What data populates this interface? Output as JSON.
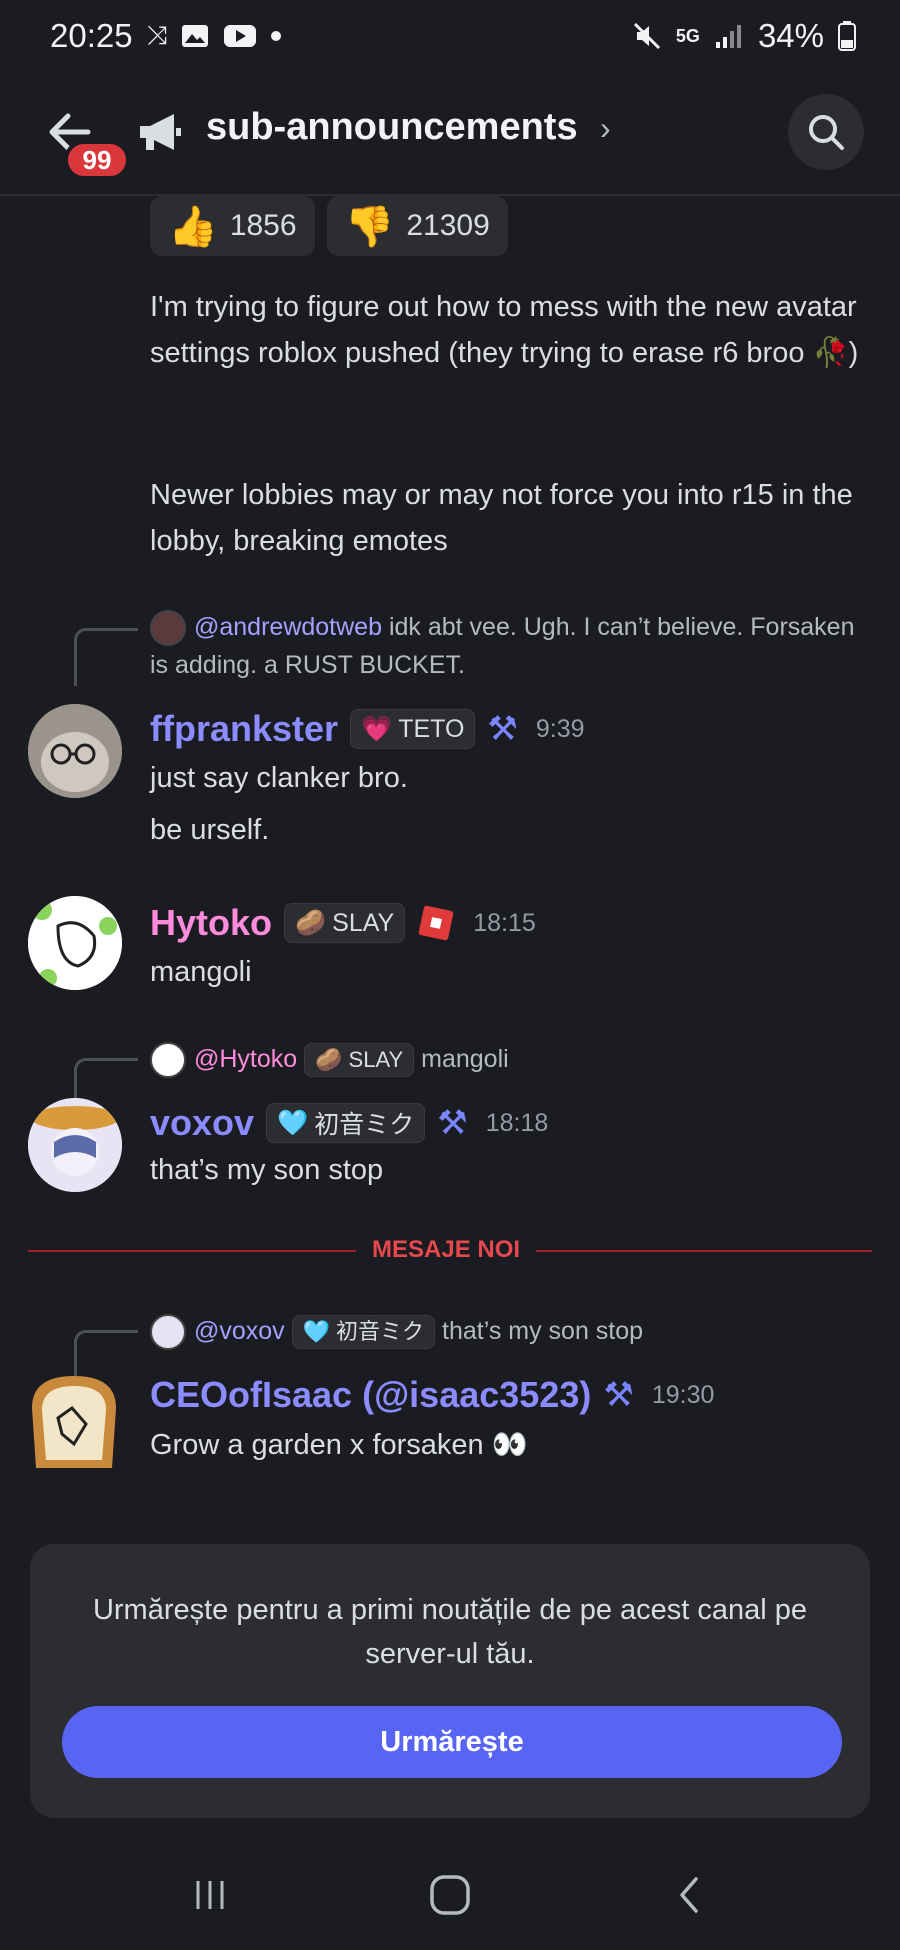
{
  "status_bar": {
    "time": "20:25",
    "icons_left": [
      "network-speed-icon",
      "gallery-icon",
      "youtube-icon",
      "dot-icon"
    ],
    "icons_right": [
      "mute-icon",
      "5g-icon",
      "signal-icon",
      "battery-icon"
    ],
    "network_label": "5G",
    "battery": "34%"
  },
  "header": {
    "unread_badge": "99",
    "channel_name": "sub-announcements",
    "chevron": "›"
  },
  "reactions": [
    {
      "emoji": "👍",
      "count": "1856"
    },
    {
      "emoji": "👎",
      "count": "21309"
    }
  ],
  "first_message": {
    "para1": "I'm trying to figure out how to mess with the new avatar settings roblox pushed (they trying to erase r6 broo 🥀)",
    "para2": "Newer lobbies may or may not force you into r15 in the lobby, breaking emotes"
  },
  "messages": [
    {
      "reply_mention": "@andrewdotweb",
      "reply_text": "idk abt vee. Ugh. I can’t believe. Forsaken is adding. a RUST BUCKET.",
      "username": "ffprankster",
      "username_color": "#8a8cff",
      "tag_label": "TETO",
      "tag_emoji": "💗",
      "timestamp": "9:39",
      "lines": [
        "just say clanker bro.",
        "be urself."
      ]
    },
    {
      "username": "Hytoko",
      "username_color": "#ff8bdc",
      "tag_label": "SLAY",
      "tag_emoji": "🥔",
      "timestamp": "18:15",
      "lines": [
        "mangoli"
      ]
    },
    {
      "reply_mention": "@Hytoko",
      "reply_tag_label": "SLAY",
      "reply_tag_emoji": "🥔",
      "reply_text": "mangoli",
      "username": "voxov",
      "username_color": "#8a8cff",
      "tag_label": "初音ミク",
      "tag_emoji": "🩵",
      "timestamp": "18:18",
      "lines": [
        "that’s my son stop"
      ]
    },
    {
      "reply_mention": "@voxov",
      "reply_tag_label": "初音ミク",
      "reply_tag_emoji": "🩵",
      "reply_text": "that’s my son stop",
      "username": "CEOofIsaac (@isaac3523)",
      "username_color": "#8a8cff",
      "timestamp": "19:30",
      "lines": [
        "Grow a garden x forsaken 👀"
      ]
    }
  ],
  "divider_label": "MESAJE NOI",
  "follow_card": {
    "text": "Urmărește pentru a primi noutățile de pe acest canal pe server-ul tău.",
    "button_label": "Urmărește"
  },
  "colors": {
    "background": "#1b1c21",
    "accent": "#5865f2",
    "badge": "#da373c",
    "divider": "#e5484d"
  }
}
